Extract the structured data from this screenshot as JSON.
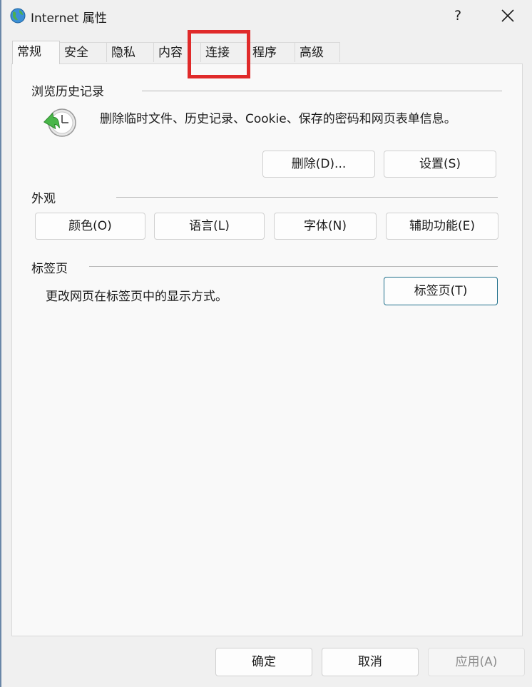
{
  "window": {
    "title": "Internet 属性",
    "help": "?",
    "accent": "#1f6f8b",
    "highlight_color": "#e02a2a"
  },
  "tabs": [
    "常规",
    "安全",
    "隐私",
    "内容",
    "连接",
    "程序",
    "高级"
  ],
  "history": {
    "label": "浏览历史记录",
    "desc": "删除临时文件、历史记录、Cookie、保存的密码和网页表单信息。",
    "delete_btn": "删除(D)...",
    "settings_btn": "设置(S)"
  },
  "appearance": {
    "label": "外观",
    "buttons": [
      "颜色(O)",
      "语言(L)",
      "字体(N)",
      "辅助功能(E)"
    ]
  },
  "tabs_section": {
    "label": "标签页",
    "desc": "更改网页在标签页中的显示方式。",
    "button": "标签页(T)"
  },
  "footer": {
    "ok": "确定",
    "cancel": "取消",
    "apply": "应用(A)"
  }
}
